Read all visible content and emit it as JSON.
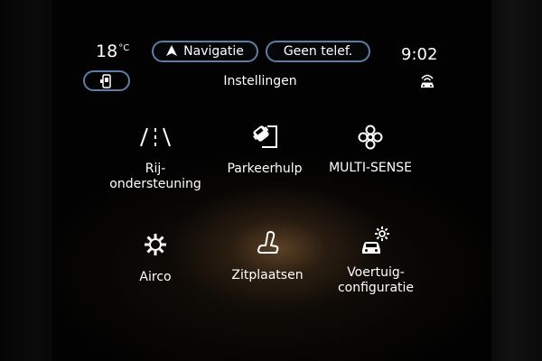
{
  "status_bar": {
    "temperature": "18",
    "temperature_unit": "°C",
    "navigation_label": "Navigatie",
    "phone_label": "Geen telef.",
    "time": "9:02"
  },
  "page": {
    "title": "Instellingen"
  },
  "tiles": [
    {
      "label": "Rij-\nondersteuning",
      "icon": "lane-assist-icon"
    },
    {
      "label": "Parkeerhulp",
      "icon": "parking-assist-icon"
    },
    {
      "label": "MULTI-SENSE",
      "icon": "multi-sense-icon"
    },
    {
      "label": "Airco",
      "icon": "climate-icon"
    },
    {
      "label": "Zitplaatsen",
      "icon": "seat-icon"
    },
    {
      "label": "Voertuig-\nconfiguratie",
      "icon": "vehicle-settings-icon"
    }
  ],
  "colors": {
    "accent_border": "#5b7ea6",
    "text": "#ffffff",
    "background": "#020202",
    "glow": "#966c3e"
  }
}
